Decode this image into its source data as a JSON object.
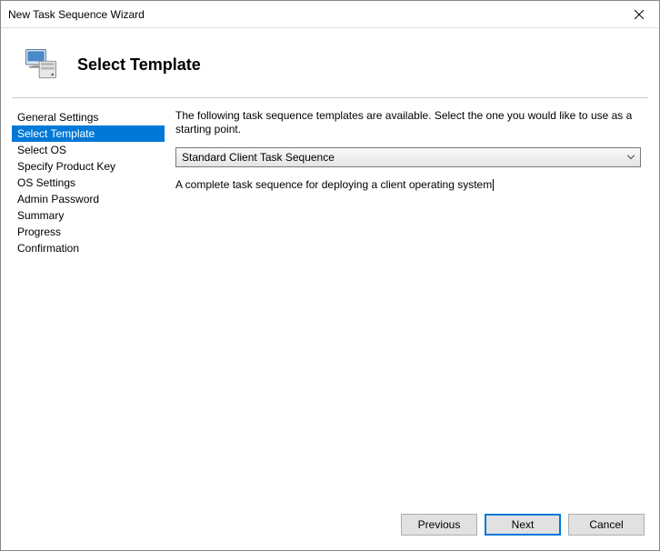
{
  "window": {
    "title": "New Task Sequence Wizard"
  },
  "header": {
    "title": "Select Template"
  },
  "sidebar": {
    "items": [
      {
        "label": "General Settings",
        "selected": false
      },
      {
        "label": "Select Template",
        "selected": true
      },
      {
        "label": "Select OS",
        "selected": false
      },
      {
        "label": "Specify Product Key",
        "selected": false
      },
      {
        "label": "OS Settings",
        "selected": false
      },
      {
        "label": "Admin Password",
        "selected": false
      },
      {
        "label": "Summary",
        "selected": false
      },
      {
        "label": "Progress",
        "selected": false
      },
      {
        "label": "Confirmation",
        "selected": false
      }
    ]
  },
  "main": {
    "instruction": "The following task sequence templates are available.  Select the one you would like to use as a starting point.",
    "dropdown": {
      "selected": "Standard Client Task Sequence"
    },
    "description": "A complete task sequence for deploying a client operating system"
  },
  "footer": {
    "previous": "Previous",
    "next": "Next",
    "cancel": "Cancel"
  }
}
